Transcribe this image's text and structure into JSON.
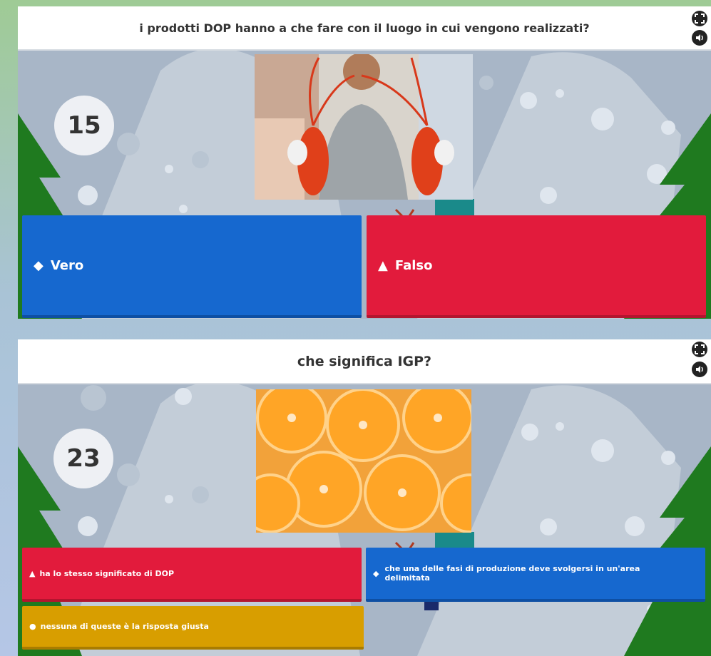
{
  "colors": {
    "blue": "#1668cf",
    "red": "#e21b3c",
    "gold": "#d89e00",
    "scene_bg": "#a8b6c7",
    "tree": "#1f7a1f"
  },
  "controls": [
    "fullscreen-icon",
    "sound-icon"
  ],
  "questions": [
    {
      "text": "i prodotti DOP hanno a che fare con il luogo in cui vengono realizzati?",
      "timer": "15",
      "image": "person-holding-lobsters",
      "answers": [
        {
          "label": "Vero",
          "symbol": "◆",
          "symbol_name": "diamond-icon",
          "color": "blue"
        },
        {
          "label": "Falso",
          "symbol": "▲",
          "symbol_name": "triangle-icon",
          "color": "red"
        }
      ]
    },
    {
      "text": "che significa IGP?",
      "timer": "23",
      "image": "sliced-oranges",
      "answers": [
        {
          "label": "ha lo stesso significato di DOP",
          "symbol": "▲",
          "symbol_name": "triangle-icon",
          "color": "red"
        },
        {
          "label": "che una delle fasi di produzione deve svolgersi in un'area delimitata",
          "symbol": "◆",
          "symbol_name": "diamond-icon",
          "color": "blue"
        },
        {
          "label": "nessuna di queste è la risposta giusta",
          "symbol": "●",
          "symbol_name": "circle-icon",
          "color": "gold"
        }
      ]
    }
  ]
}
